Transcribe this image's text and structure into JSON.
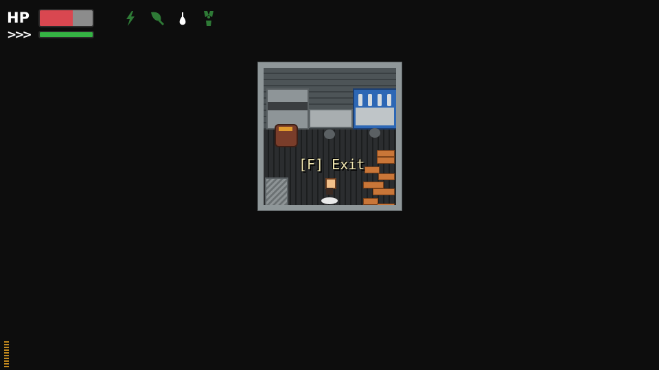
{
  "hud": {
    "hp_label": "HP",
    "hp_fraction": 0.62,
    "stamina_label": ">>>",
    "stamina_fraction": 1.0,
    "status_icons": [
      "lightning-icon",
      "leaf-icon",
      "drop-icon",
      "radiation-icon"
    ],
    "colors": {
      "hp_fill": "#d94750",
      "hp_empty": "#8c8c8c",
      "stamina_fill": "#35b344",
      "status_icon": "#2e7a36"
    }
  },
  "prompt": {
    "text": "[F] Exit"
  }
}
